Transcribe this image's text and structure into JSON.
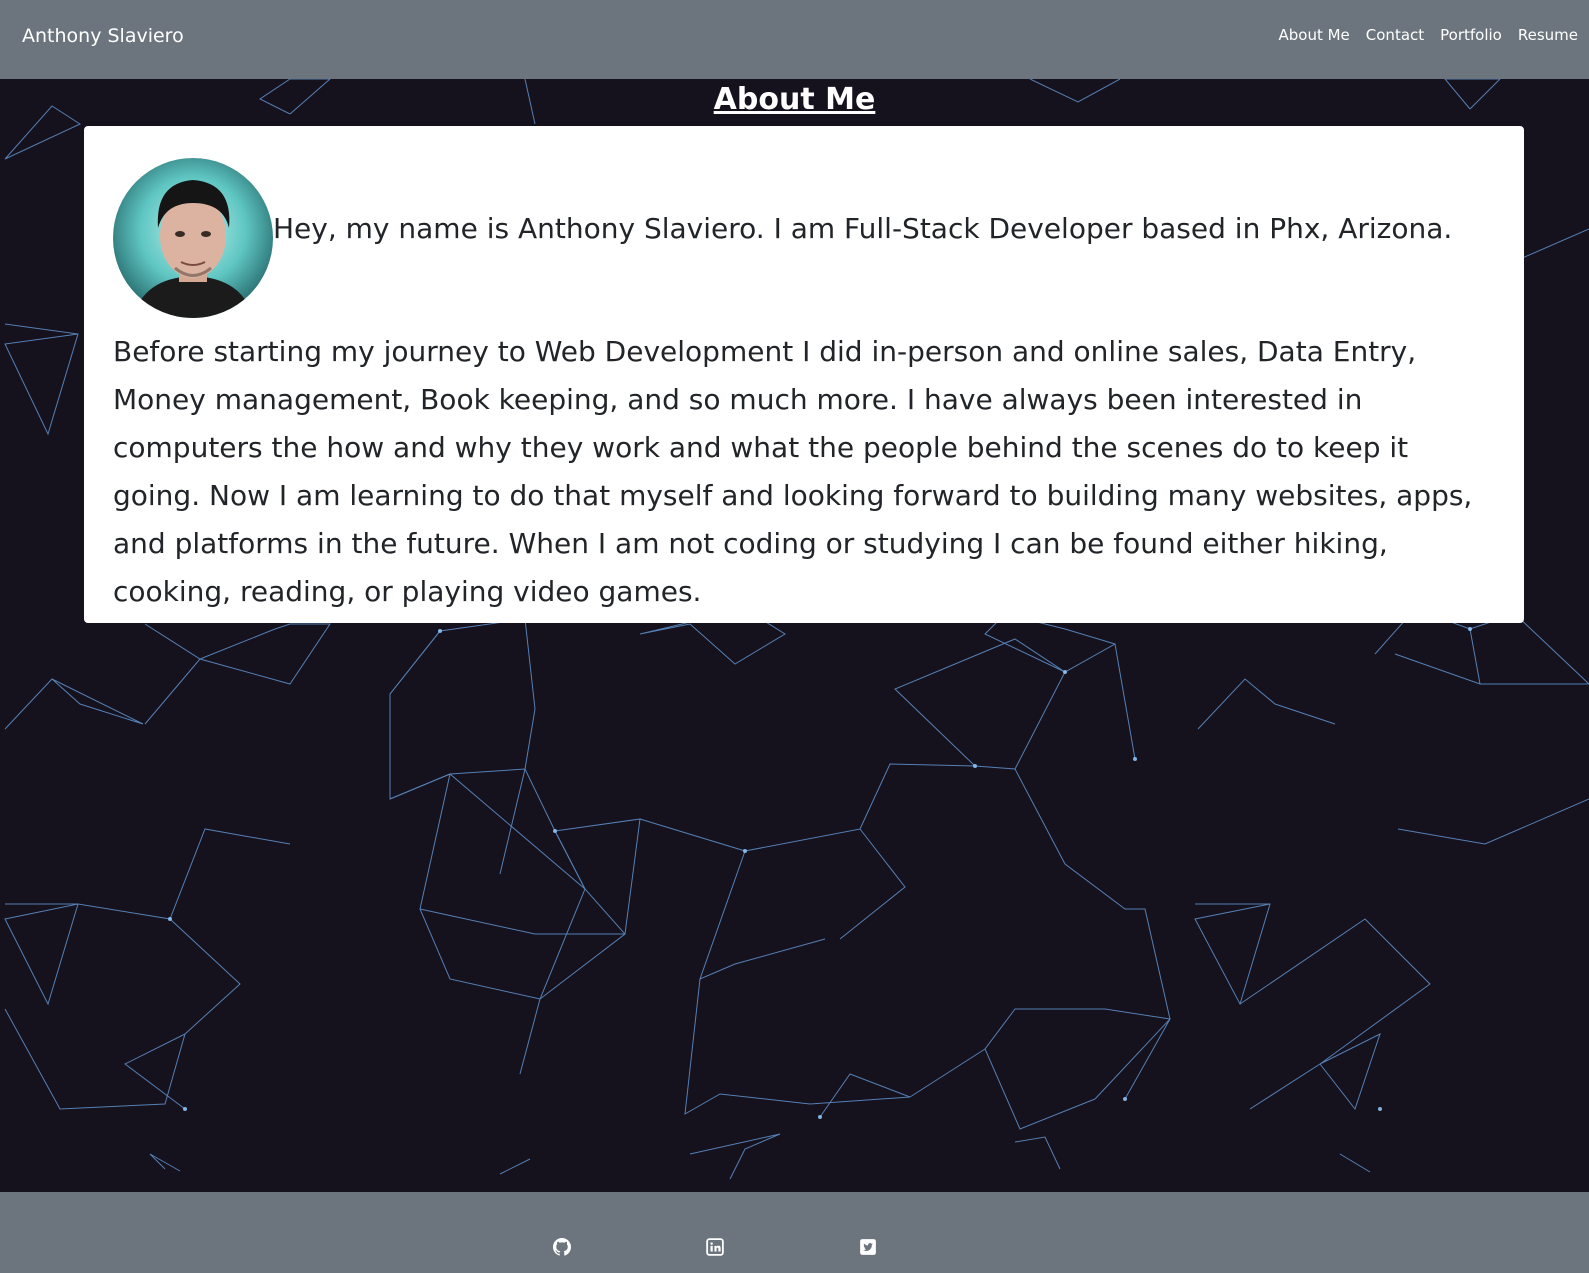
{
  "navbar": {
    "brand": "Anthony Slaviero",
    "links": [
      "About Me",
      "Contact",
      "Portfolio",
      "Resume"
    ]
  },
  "about": {
    "title": "About Me",
    "intro": "Hey, my name is Anthony Slaviero. I am Full-Stack Developer based in Phx, Arizona.",
    "bio": "Before starting my journey to Web Development I did in-person and online sales, Data Entry, Money management, Book keeping, and so much more. I have always been interested in computers the how and why they work and what the people behind the scenes do to keep it going. Now I am learning to do that myself and looking forward to building many websites, apps, and platforms in the future. When I am not coding or studying I can be found either hiking, cooking, reading, or playing video games."
  },
  "footer": {
    "icons": [
      "github-icon",
      "linkedin-icon",
      "twitter-icon"
    ]
  },
  "colors": {
    "navbar": "#6c757d",
    "background": "#15111d",
    "network_lines": "#6aa6e8",
    "card": "#ffffff",
    "text": "#212529"
  }
}
